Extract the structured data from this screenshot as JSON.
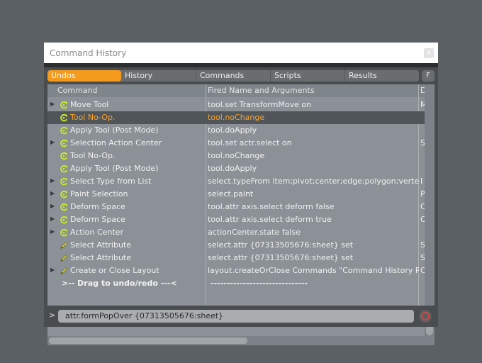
{
  "window": {
    "title": "Command History",
    "close_label": "x"
  },
  "tabs": [
    {
      "label": "Undos",
      "active": true
    },
    {
      "label": "History",
      "active": false
    },
    {
      "label": "Commands",
      "active": false
    },
    {
      "label": "Scripts",
      "active": false
    },
    {
      "label": "Results",
      "active": false
    }
  ],
  "filter_button_label": "F",
  "columns": {
    "command": "Command",
    "fired": "Fired Name and Arguments",
    "extra": "D"
  },
  "rows": [
    {
      "expand": true,
      "icon": "undo-icon",
      "command": "Move Tool",
      "fired": "tool.set TransformMove on",
      "extra": "M",
      "selected": false
    },
    {
      "expand": false,
      "icon": "undo-icon",
      "command": "Tool No-Op.",
      "fired": "tool.noChange",
      "extra": "",
      "selected": true
    },
    {
      "expand": false,
      "icon": "undo-icon",
      "command": "Apply Tool (Post Mode)",
      "fired": "tool.doApply",
      "extra": "",
      "selected": false
    },
    {
      "expand": true,
      "icon": "undo-icon",
      "command": "Selection Action Center",
      "fired": "tool.set actr.select on",
      "extra": "S",
      "selected": false
    },
    {
      "expand": false,
      "icon": "undo-icon",
      "command": "Tool No-Op.",
      "fired": "tool.noChange",
      "extra": "",
      "selected": false
    },
    {
      "expand": false,
      "icon": "undo-icon",
      "command": "Apply Tool (Post Mode)",
      "fired": "tool.doApply",
      "extra": "",
      "selected": false
    },
    {
      "expand": true,
      "icon": "undo-icon",
      "command": "Select Type from List",
      "fired": "select.typeFrom item;pivot;center;edge;polygon;vertex;p ...",
      "extra": "I",
      "selected": false
    },
    {
      "expand": true,
      "icon": "undo-icon",
      "command": "Paint Selection",
      "fired": "select.paint",
      "extra": "P",
      "selected": false
    },
    {
      "expand": true,
      "icon": "undo-icon",
      "command": "Deform Space",
      "fired": "tool.attr axis.select deform false",
      "extra": "C",
      "selected": false
    },
    {
      "expand": true,
      "icon": "undo-icon",
      "command": "Deform Space",
      "fired": "tool.attr axis.select deform true",
      "extra": "C",
      "selected": false
    },
    {
      "expand": true,
      "icon": "undo-icon",
      "command": "Action Center",
      "fired": "actionCenter.state false",
      "extra": "",
      "selected": false
    },
    {
      "expand": false,
      "icon": "pencil-icon",
      "command": "Select Attribute",
      "fired": "select.attr {07313505676:sheet} set",
      "extra": "S",
      "selected": false
    },
    {
      "expand": false,
      "icon": "pencil-icon",
      "command": "Select Attribute",
      "fired": "select.attr {07313505676:sheet} set",
      "extra": "S",
      "selected": false
    },
    {
      "expand": true,
      "icon": "pencil-icon",
      "command": "Create or Close Layout",
      "fired": "layout.createOrClose Commands \"Command History Palett ...",
      "extra": "C",
      "selected": false
    }
  ],
  "drag_row": {
    "command": ">-- Drag to undo/redo ---<",
    "fired": "------------------------------"
  },
  "command_line": {
    "prompt": ">",
    "value": "attr.formPopOver {07313505676:sheet}"
  },
  "colors": {
    "accent": "#f49a1c",
    "selected_row": "#50555a",
    "panel": "#8b9196",
    "undo_icon": "#c8e825"
  }
}
